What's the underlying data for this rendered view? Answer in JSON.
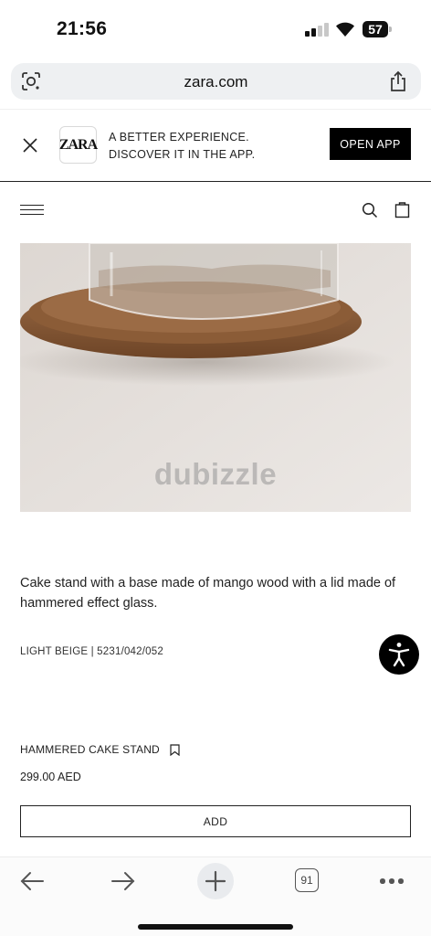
{
  "status_bar": {
    "time": "21:56",
    "battery_level": "57",
    "icons": [
      "signal-icon",
      "wifi-icon",
      "battery-icon"
    ]
  },
  "browser": {
    "url": "zara.com",
    "icons": [
      "lens-icon",
      "share-icon"
    ]
  },
  "app_banner": {
    "brand": "ZARA",
    "line1": "A BETTER EXPERIENCE.",
    "line2": "DISCOVER IT IN THE APP.",
    "cta": "OPEN APP"
  },
  "header": {
    "icons": [
      "menu-icon",
      "search-icon",
      "bag-icon"
    ]
  },
  "product": {
    "watermark": "dubizzle",
    "description": "Cake stand with a base made of mango wood with a lid made of hammered effect glass.",
    "color_ref": "LIGHT BEIGE | 5231/042/052",
    "name": "HAMMERED CAKE STAND",
    "price": "299.00 AED",
    "add_label": "ADD"
  },
  "toolbar": {
    "tab_count": "91",
    "icons": [
      "back-arrow-icon",
      "forward-arrow-icon",
      "plus-icon",
      "tabs-icon",
      "more-icon"
    ]
  },
  "colors": {
    "accent": "#000000",
    "image_background": "#e3dfdb",
    "wood": "#8a5a36",
    "address_bar": "#eef0f2"
  }
}
